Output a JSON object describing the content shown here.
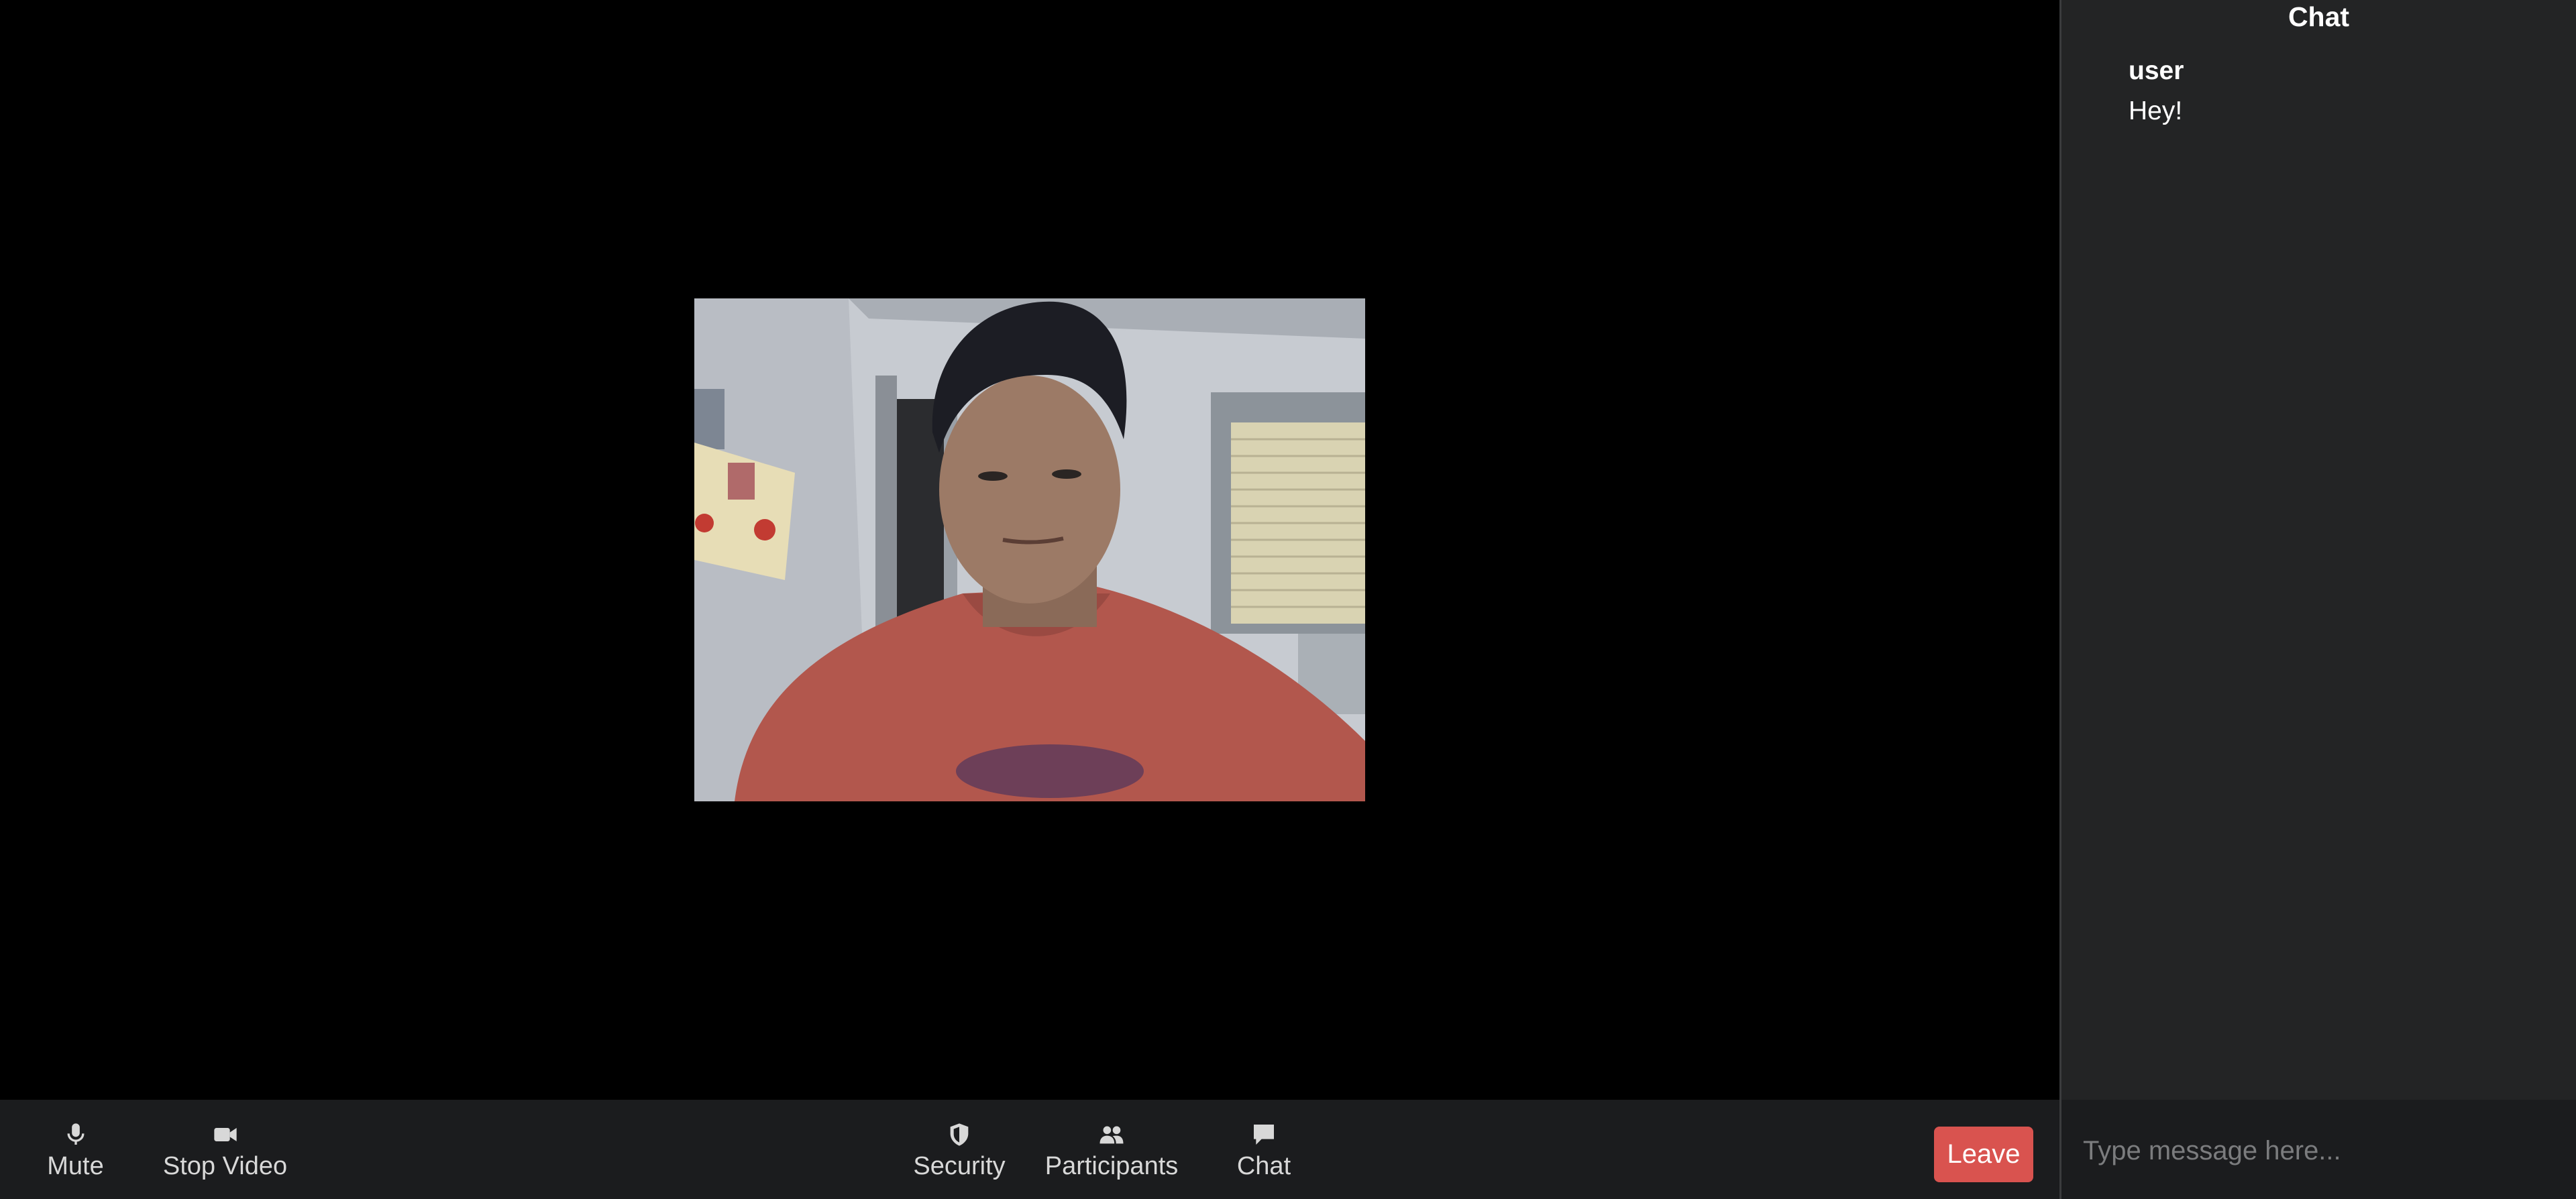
{
  "toolbar": {
    "mute_label": "Mute",
    "stop_video_label": "Stop Video",
    "security_label": "Security",
    "participants_label": "Participants",
    "chat_label": "Chat",
    "leave_label": "Leave"
  },
  "chat": {
    "title": "Chat",
    "messages": [
      {
        "sender": "user",
        "text": "Hey!"
      }
    ],
    "input_placeholder": "Type message here..."
  },
  "colors": {
    "toolbar_bg": "#1b1c1e",
    "chat_bg": "#232425",
    "leave_button": "#d9534f",
    "video_bg": "#000000"
  },
  "icons": [
    "microphone-icon",
    "video-camera-icon",
    "shield-icon",
    "participants-icon",
    "chat-bubble-icon"
  ]
}
